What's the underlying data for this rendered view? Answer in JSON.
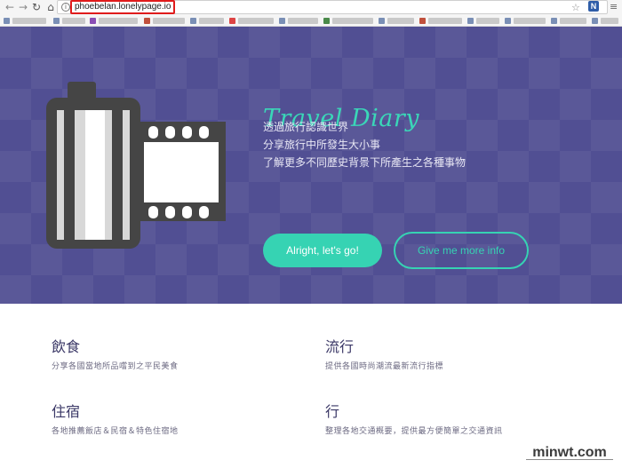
{
  "browser": {
    "url": "phoebelan.lonelypage.io",
    "back_icon": "back-arrow",
    "forward_icon": "forward-arrow",
    "reload_icon": "reload",
    "home_icon": "home",
    "extension_label": "N"
  },
  "hero": {
    "title": "Travel Diary",
    "lines": [
      "透過旅行認識世界",
      "分享旅行中所發生大小事",
      "了解更多不同歷史背景下所產生之各種事物"
    ],
    "primary_button": "Alright, let's go!",
    "secondary_button": "Give me more info",
    "colors": {
      "background": "#514f93",
      "accent": "#36d3b3"
    }
  },
  "features": [
    {
      "title": "飲食",
      "desc": "分享各國當地所品嚐到之平民美食"
    },
    {
      "title": "流行",
      "desc": "提供各國時尚潮流最新流行指標"
    },
    {
      "title": "住宿",
      "desc": "各地推薦飯店＆民宿＆特色住宿地"
    },
    {
      "title": "行",
      "desc": "整理各地交通概要，提供最方便簡單之交通資訊"
    }
  ],
  "watermark": {
    "text": "minwt.com"
  }
}
